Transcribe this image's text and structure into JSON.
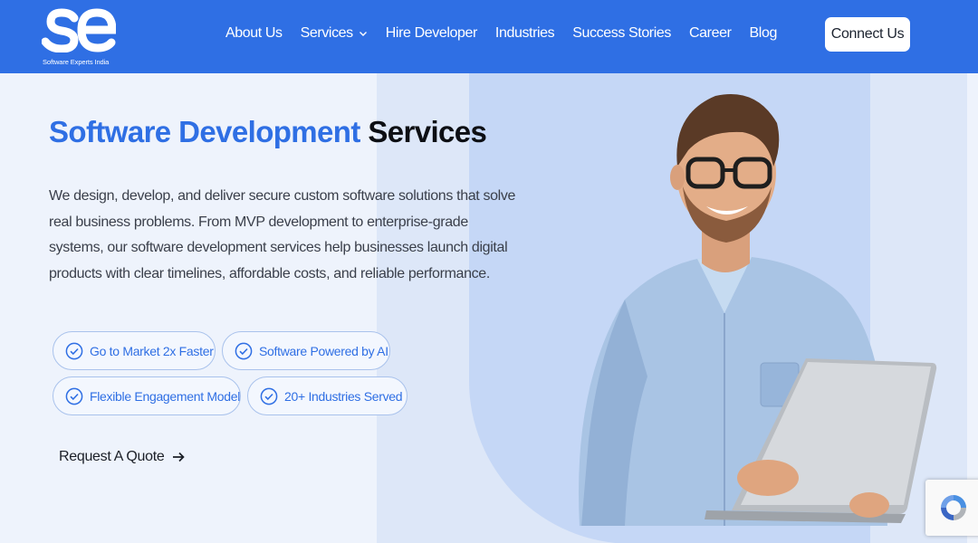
{
  "brand": {
    "logo_text": "Software Experts India",
    "color": "#2f6fe4"
  },
  "nav": {
    "items": [
      {
        "label": "About Us"
      },
      {
        "label": "Services",
        "has_dropdown": true
      },
      {
        "label": "Hire Developer"
      },
      {
        "label": "Industries"
      },
      {
        "label": "Success Stories"
      },
      {
        "label": "Career"
      },
      {
        "label": "Blog"
      }
    ],
    "cta_label": "Connect Us"
  },
  "hero": {
    "title_accent": "Software Development",
    "title_plain": "Services",
    "description": "We design, develop, and deliver secure custom software solutions that solve real business problems. From MVP development to enterprise-grade systems, our software development services help businesses launch digital products with clear timelines, affordable costs, and reliable performance.",
    "chips": [
      {
        "label": "Go to Market 2x Faster"
      },
      {
        "label": "Software Powered by AI"
      },
      {
        "label": "Flexible Engagement Model"
      },
      {
        "label": "20+ Industries Served"
      }
    ],
    "cta_label": "Request A Quote"
  },
  "icons": {
    "chip_icon": "check-circle-icon",
    "cta_icon": "arrow-right-icon",
    "dropdown_icon": "chevron-down-icon",
    "recaptcha_icon": "recaptcha-icon"
  }
}
